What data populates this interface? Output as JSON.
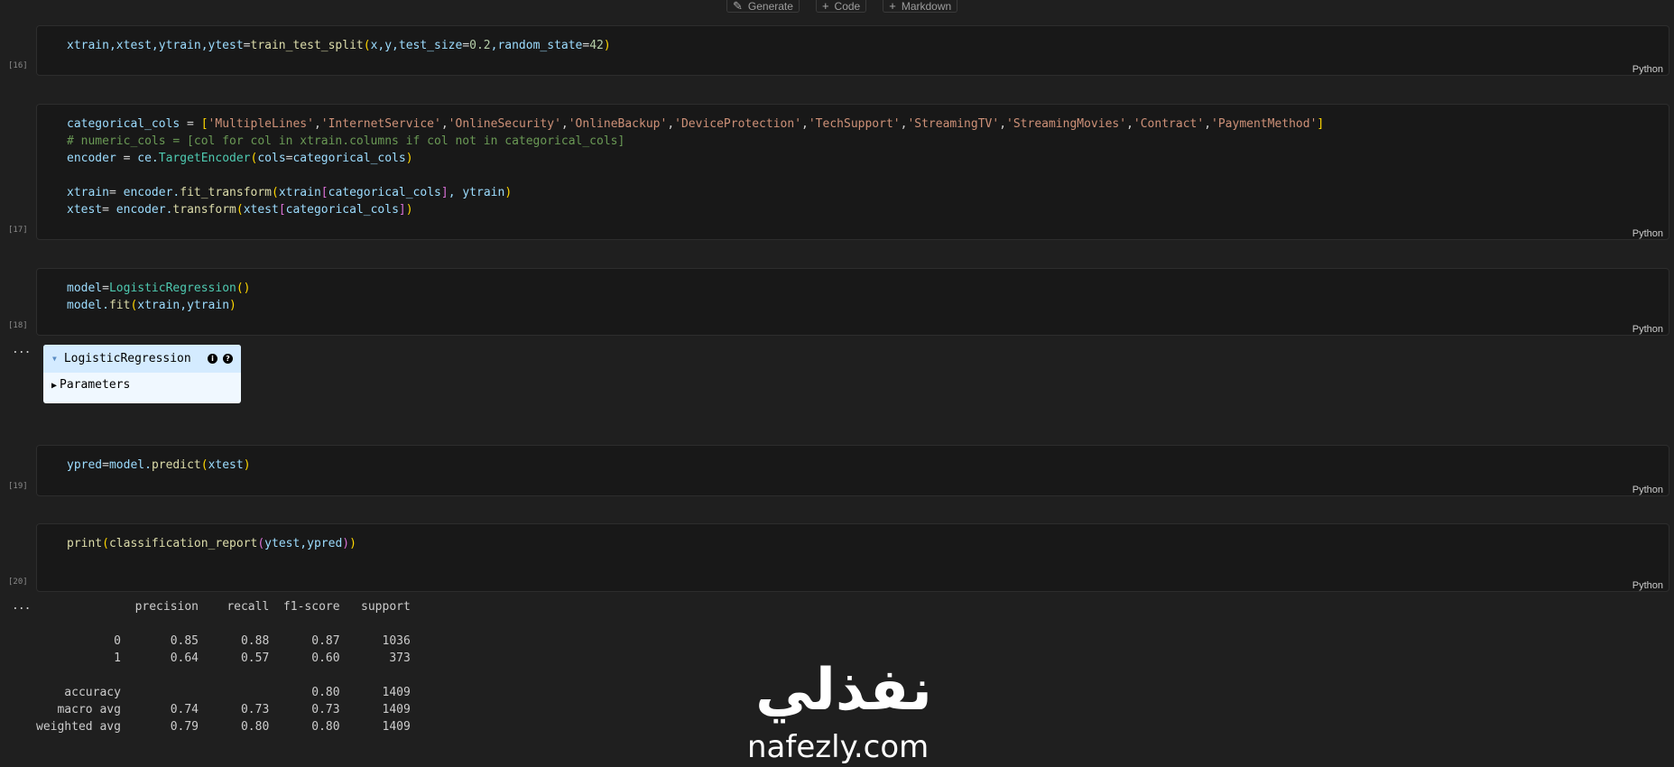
{
  "toolbar": {
    "generate_label": "Generate",
    "code_label": "Code",
    "markdown_label": "Markdown"
  },
  "cells": [
    {
      "count": "[16]",
      "language": "Python"
    },
    {
      "count": "[17]",
      "language": "Python"
    },
    {
      "count": "[18]",
      "language": "Python"
    },
    {
      "count": "[19]",
      "language": "Python"
    },
    {
      "count": "[20]",
      "language": "Python"
    }
  ],
  "code": {
    "c16": {
      "t1": "xtrain,xtest,ytrain,ytest",
      "t2": "=",
      "t3": "train_test_split",
      "t4": "(",
      "t5": "x,y,test_size",
      "t6": "=",
      "t7": "0.2",
      "t8": ",random_state",
      "t9": "=",
      "t10": "42",
      "t11": ")"
    },
    "c17": {
      "l1_var": "categorical_cols",
      "l1_eq": " = ",
      "l1_open": "[",
      "s1": "'MultipleLines'",
      "s2": "'InternetService'",
      "s3": "'OnlineSecurity'",
      "s4": "'OnlineBackup'",
      "s5": "'DeviceProtection'",
      "s6": "'TechSupport'",
      "s7": "'StreamingTV'",
      "s8": "'StreamingMovies'",
      "s9": "'Contract'",
      "s10": "'PaymentMethod'",
      "comma": ",",
      "l1_close": "]",
      "l2_comment": "# numeric_cols = [col for col in xtrain.columns if col not in categorical_cols]",
      "l3_var": "encoder",
      "l3_eq": " = ",
      "l3_mod": "ce.",
      "l3_cls": "TargetEncoder",
      "l3_open": "(",
      "l3_arg": "cols",
      "l3_eq2": "=",
      "l3_val": "categorical_cols",
      "l3_close": ")",
      "l5_var": "xtrain",
      "l5_eq": "= ",
      "l5_obj": "encoder.",
      "l5_fn": "fit_transform",
      "l5_open": "(",
      "l5_a": "xtrain",
      "l5_b1": "[",
      "l5_b": "categorical_cols",
      "l5_b2": "]",
      "l5_c": ", ytrain",
      "l5_close": ")",
      "l6_var": "xtest",
      "l6_eq": "= ",
      "l6_obj": "encoder.",
      "l6_fn": "transform",
      "l6_open": "(",
      "l6_a": "xtest",
      "l6_b1": "[",
      "l6_b": "categorical_cols",
      "l6_b2": "]",
      "l6_close": ")"
    },
    "c18": {
      "l1_var": "model",
      "l1_eq": "=",
      "l1_cls": "LogisticRegression",
      "l1_paren": "()",
      "l2_obj": "model.",
      "l2_fn": "fit",
      "l2_open": "(",
      "l2_args": "xtrain,ytrain",
      "l2_close": ")"
    },
    "c19": {
      "var": "ypred",
      "eq": "=",
      "obj": "model.",
      "fn": "predict",
      "open": "(",
      "arg": "xtest",
      "close": ")"
    },
    "c20": {
      "fn": "print",
      "o1": "(",
      "fn2": "classification_report",
      "o2": "(",
      "args": "ytest,ypred",
      "c2": ")",
      "c1": ")"
    }
  },
  "output_ellipsis": "...",
  "estimator": {
    "name": "LogisticRegression",
    "info_icon": "i",
    "help_icon": "?",
    "params_label": "Parameters"
  },
  "report": {
    "header": "              precision    recall  f1-score   support",
    "row0": "           0       0.85      0.88      0.87      1036",
    "row1": "           1       0.64      0.57      0.60       373",
    "accuracy": "    accuracy                           0.80      1409",
    "macro": "   macro avg       0.74      0.73      0.73      1409",
    "weighted": "weighted avg       0.79      0.80      0.80      1409"
  },
  "watermark": {
    "arabic": "نفذلي",
    "latin": "nafezly.com"
  }
}
